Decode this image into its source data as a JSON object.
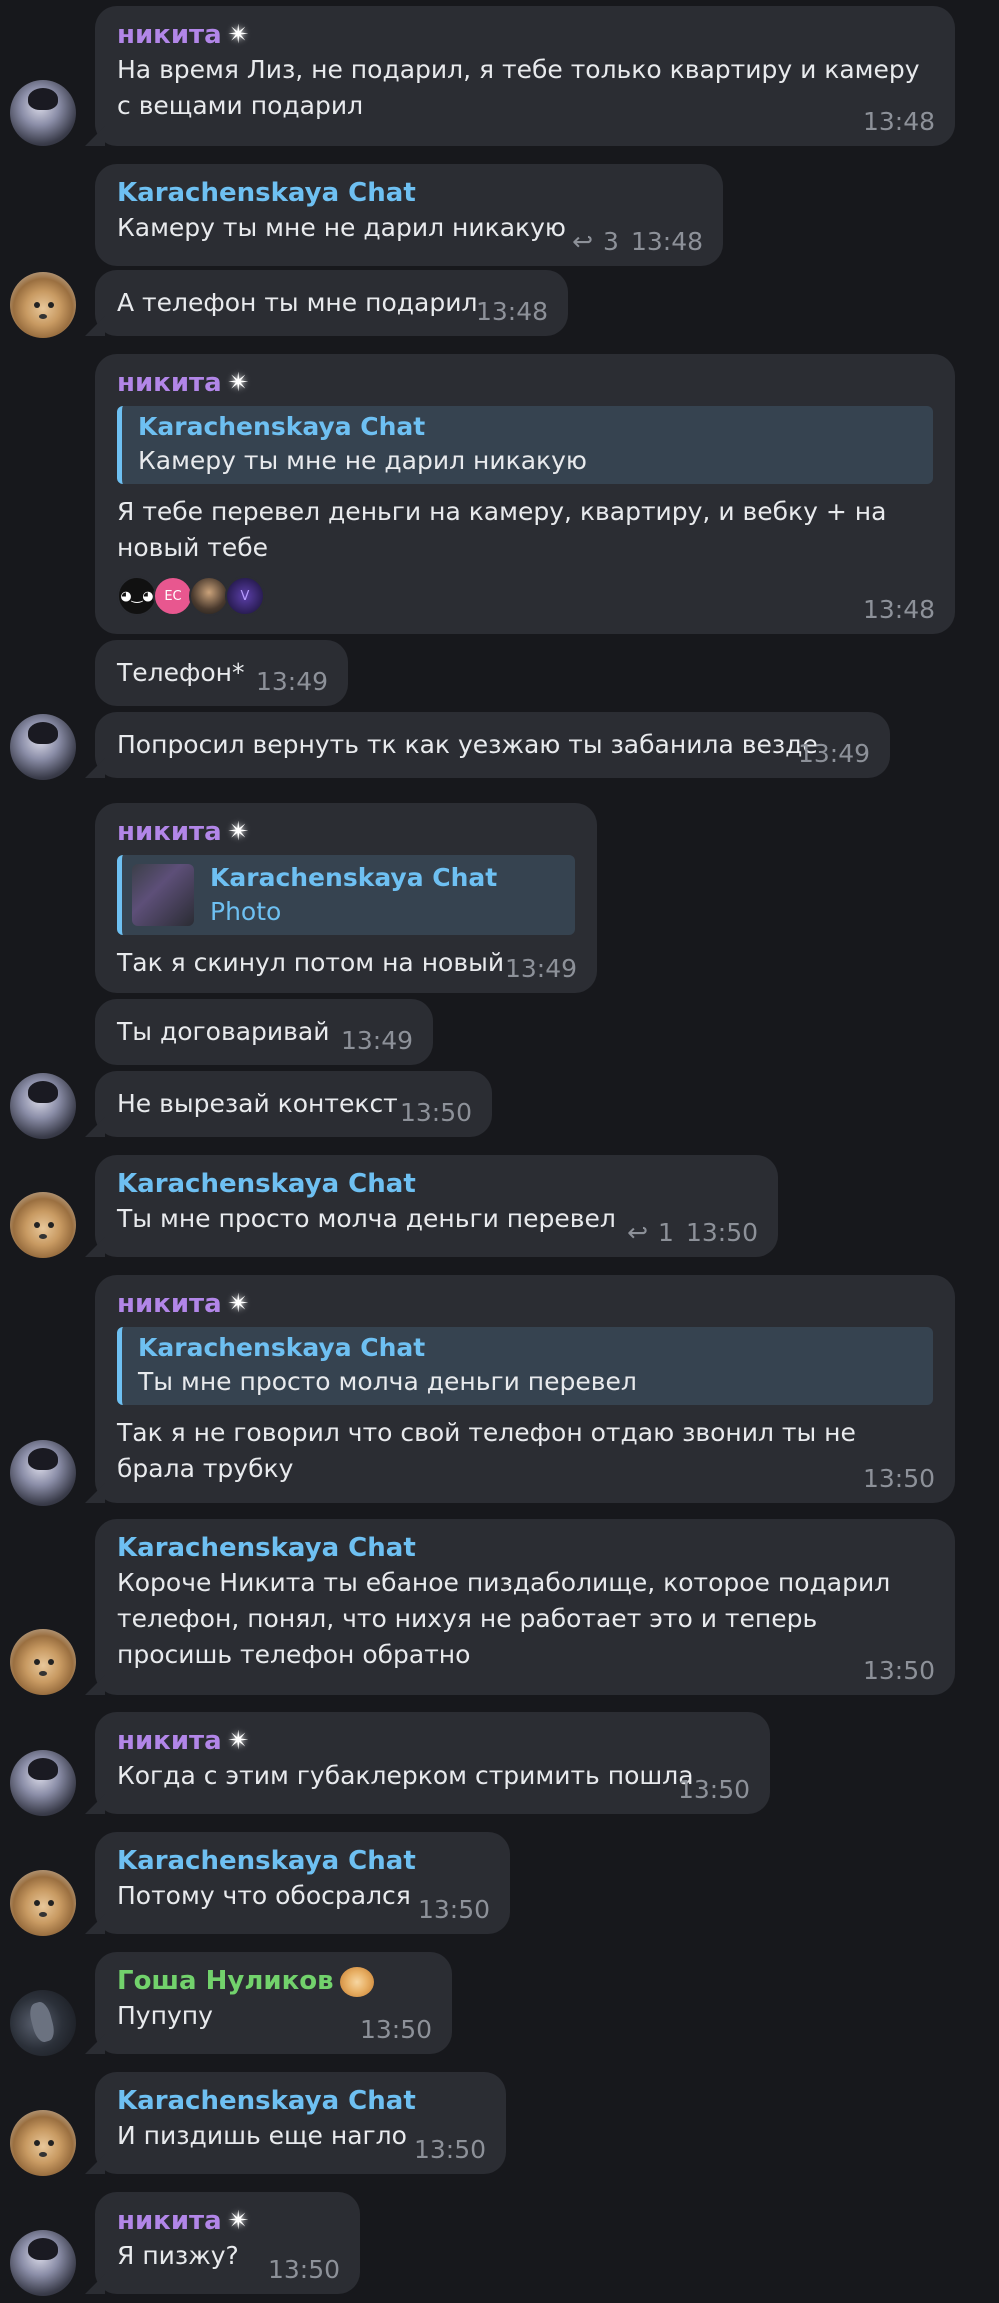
{
  "messages": [
    {
      "id": "m1",
      "sender": "никита",
      "sender_kind": "nik",
      "text": "На время Лиз, не подарил, я тебе только квартиру и камеру с вещами подарил",
      "time": "13:48"
    },
    {
      "id": "m2",
      "sender": "Karachenskaya Chat",
      "sender_kind": "kar",
      "text": "Камеру ты мне не дарил никакую",
      "time": "13:48",
      "reply_count": "3"
    },
    {
      "id": "m3",
      "text": "А телефон ты мне подарил",
      "time": "13:48"
    },
    {
      "id": "m4",
      "sender": "никита",
      "sender_kind": "nik",
      "quote": {
        "name": "Karachenskaya Chat",
        "text": "Камеру ты мне не дарил никакую"
      },
      "text": "Я тебе перевел деньги на камеру, квартиру, и вебку + на новый тебе",
      "time": "13:48",
      "reactions": [
        "",
        "EC",
        "",
        ""
      ]
    },
    {
      "id": "m5",
      "text": "Телефон*",
      "time": "13:49"
    },
    {
      "id": "m6",
      "text": "Попросил вернуть тк как уезжаю ты забанила везде",
      "time": "13:49"
    },
    {
      "id": "m7",
      "sender": "никита",
      "sender_kind": "nik",
      "quote": {
        "name": "Karachenskaya Chat",
        "text": "Photo"
      },
      "text": "Так я скинул потом на новый",
      "time": "13:49"
    },
    {
      "id": "m8",
      "text": "Ты договаривай",
      "time": "13:49"
    },
    {
      "id": "m9",
      "text": "Не вырезай контекст",
      "time": "13:50"
    },
    {
      "id": "m10",
      "sender": "Karachenskaya Chat",
      "sender_kind": "kar",
      "text": "Ты мне просто молча деньги перевел",
      "time": "13:50",
      "reply_count": "1"
    },
    {
      "id": "m11",
      "sender": "никита",
      "sender_kind": "nik",
      "quote": {
        "name": "Karachenskaya Chat",
        "text": "Ты мне просто молча деньги перевел"
      },
      "text": "Так я не говорил что свой телефон отдаю звонил ты не брала трубку",
      "time": "13:50"
    },
    {
      "id": "m12",
      "sender": "Karachenskaya Chat",
      "sender_kind": "kar",
      "text": "Короче Никита ты ебаное пиздаболище, которое подарил телефон, понял, что нихуя не работает это и теперь просишь телефон обратно",
      "time": "13:50"
    },
    {
      "id": "m13",
      "sender": "никита",
      "sender_kind": "nik",
      "text": "Когда с этим губаклерком стримить пошла",
      "time": "13:50"
    },
    {
      "id": "m14",
      "sender": "Karachenskaya Chat",
      "sender_kind": "kar",
      "text": "Потому что обосрался",
      "time": "13:50"
    },
    {
      "id": "m15",
      "sender": "Гоша Нуликов",
      "sender_kind": "gosha",
      "text": "Пупупу",
      "time": "13:50"
    },
    {
      "id": "m16",
      "sender": "Karachenskaya Chat",
      "sender_kind": "kar",
      "text": "И пиздишь еще нагло",
      "time": "13:50"
    },
    {
      "id": "m17",
      "sender": "никита",
      "sender_kind": "nik",
      "text": "Я пизжу?",
      "time": "13:50"
    }
  ],
  "icons": {
    "reply": "reply-arrow-icon",
    "premium": "sparkle-star-icon"
  },
  "colors": {
    "background": "#17181c",
    "bubble": "#2b2d33",
    "nikita": "#b286e8",
    "karachenskaya": "#6ec0f2",
    "gosha": "#72d26c",
    "time": "#8d9199"
  }
}
